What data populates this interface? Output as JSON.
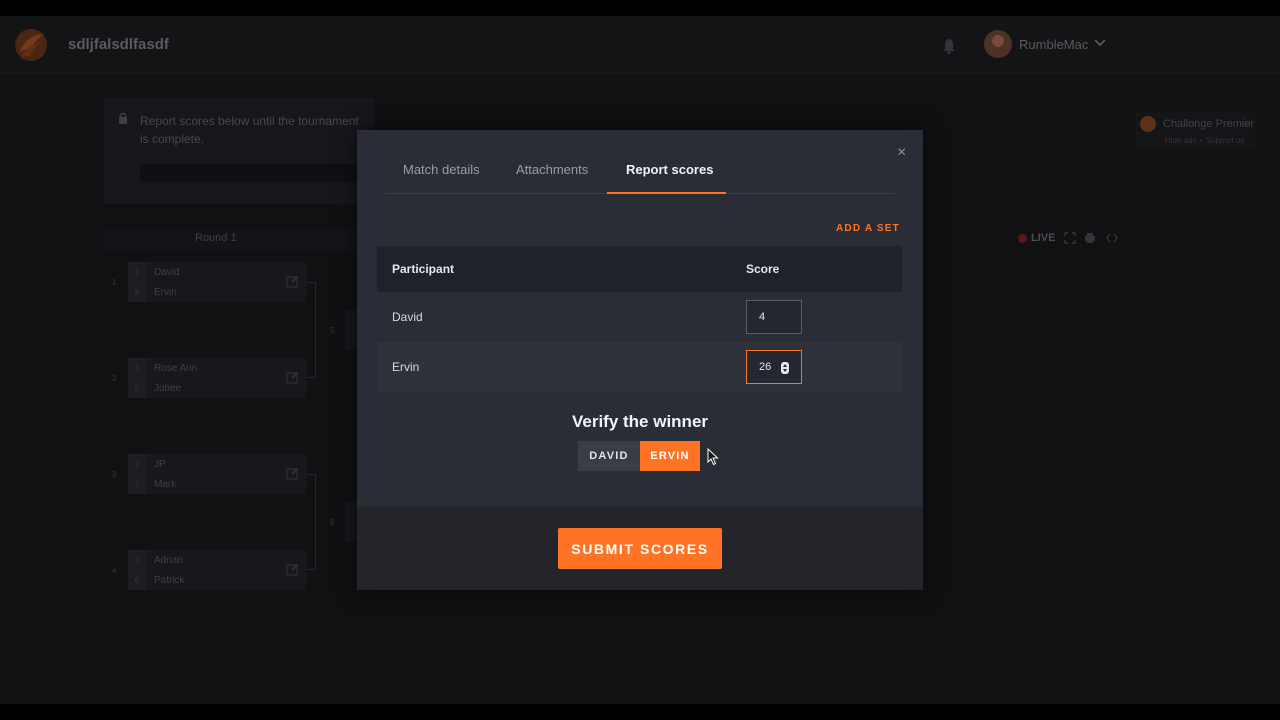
{
  "header": {
    "site_title": "sdljfalsdlfasdf",
    "username": "RumbleMac"
  },
  "notice": {
    "text": "Report scores below until the tournament is complete."
  },
  "bracket": {
    "round_label": "Round 1",
    "matches": [
      {
        "number": "1",
        "players": [
          {
            "seed": "1",
            "name": "David"
          },
          {
            "seed": "8",
            "name": "Ervin"
          }
        ]
      },
      {
        "number": "2",
        "players": [
          {
            "seed": "4",
            "name": "Rose Ann"
          },
          {
            "seed": "5",
            "name": "Jobee"
          }
        ]
      },
      {
        "number": "3",
        "players": [
          {
            "seed": "2",
            "name": "JP"
          },
          {
            "seed": "7",
            "name": "Mark"
          }
        ]
      },
      {
        "number": "4",
        "players": [
          {
            "seed": "3",
            "name": "Adrian"
          },
          {
            "seed": "6",
            "name": "Patrick"
          }
        ]
      }
    ],
    "next_round_numbers": [
      "5",
      "6"
    ]
  },
  "sponsor": {
    "name": "Challonge Premier",
    "sub": "Hide ads + Support us"
  },
  "live_label": "LIVE",
  "colors": {
    "accent": "#ff7324",
    "modal_bg": "#2a2d35",
    "page_bg": "#141518"
  },
  "modal": {
    "close_label": "×",
    "tabs": [
      {
        "label": "Match details",
        "active": false
      },
      {
        "label": "Attachments",
        "active": false
      },
      {
        "label": "Report scores",
        "active": true
      }
    ],
    "add_set_label": "ADD A SET",
    "table": {
      "col_participant": "Participant",
      "col_score": "Score",
      "rows": [
        {
          "participant": "David",
          "score": "4"
        },
        {
          "participant": "Ervin",
          "score": "26"
        }
      ]
    },
    "verify_title": "Verify the winner",
    "winner_options": [
      "DAVID",
      "ERVIN"
    ],
    "selected_winner": "ERVIN",
    "submit_label": "SUBMIT SCORES"
  },
  "icons": {
    "logo": "challonge-logo-icon",
    "bell": "bell-icon",
    "chevron": "chevron-down-icon",
    "lock": "lock-icon",
    "edit": "edit-icon",
    "cursor": "mouse-pointer-icon"
  }
}
